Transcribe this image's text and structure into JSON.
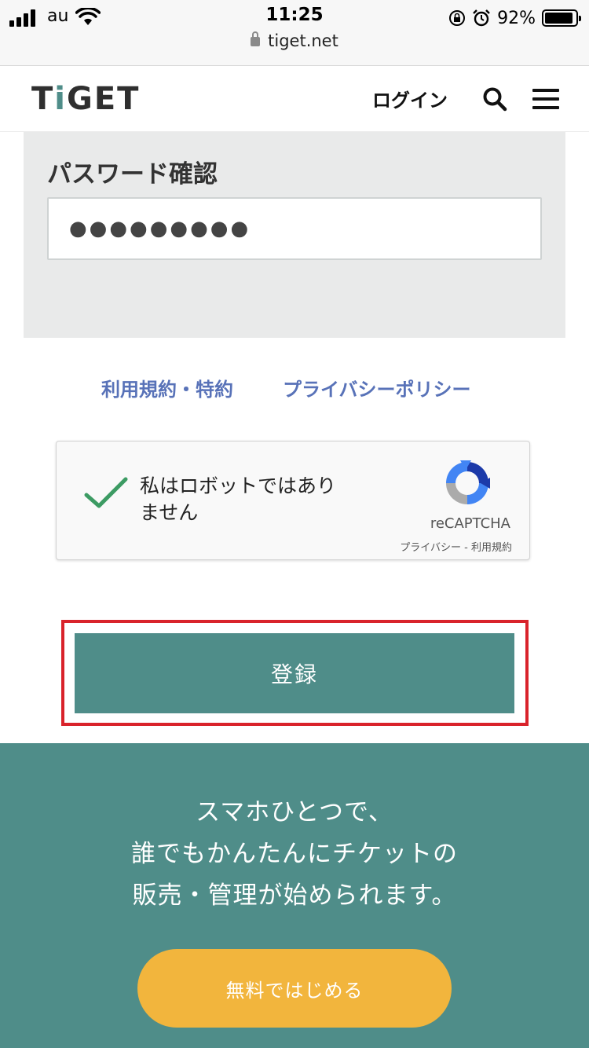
{
  "status_bar": {
    "carrier": "au",
    "time": "11:25",
    "battery_percent": "92%",
    "battery_level": 0.92,
    "url": "tiget.net"
  },
  "header": {
    "logo_before": "T",
    "logo_accent": "i",
    "logo_after": "GET",
    "login_label": "ログイン",
    "accent_color": "#4f8d89"
  },
  "form": {
    "password_confirm_label": "パスワード確認",
    "password_confirm_value": "●●●●●●●●●"
  },
  "links": {
    "terms": "利用規約・特約",
    "privacy": "プライバシーポリシー"
  },
  "captcha": {
    "label_line1": "私はロボットではあり",
    "label_line2": "ません",
    "brand": "reCAPTCHA",
    "privacy": "プライバシー",
    "separator": " - ",
    "terms": "利用規約"
  },
  "register": {
    "button_label": "登録",
    "highlight_color": "#d9232b"
  },
  "footer": {
    "tagline_line1": "スマホひとつで、",
    "tagline_line2": "誰でもかんたんにチケットの",
    "tagline_line3": "販売・管理が始められます。",
    "cta_label": "無料ではじめる",
    "cta_color": "#f2b53d"
  }
}
